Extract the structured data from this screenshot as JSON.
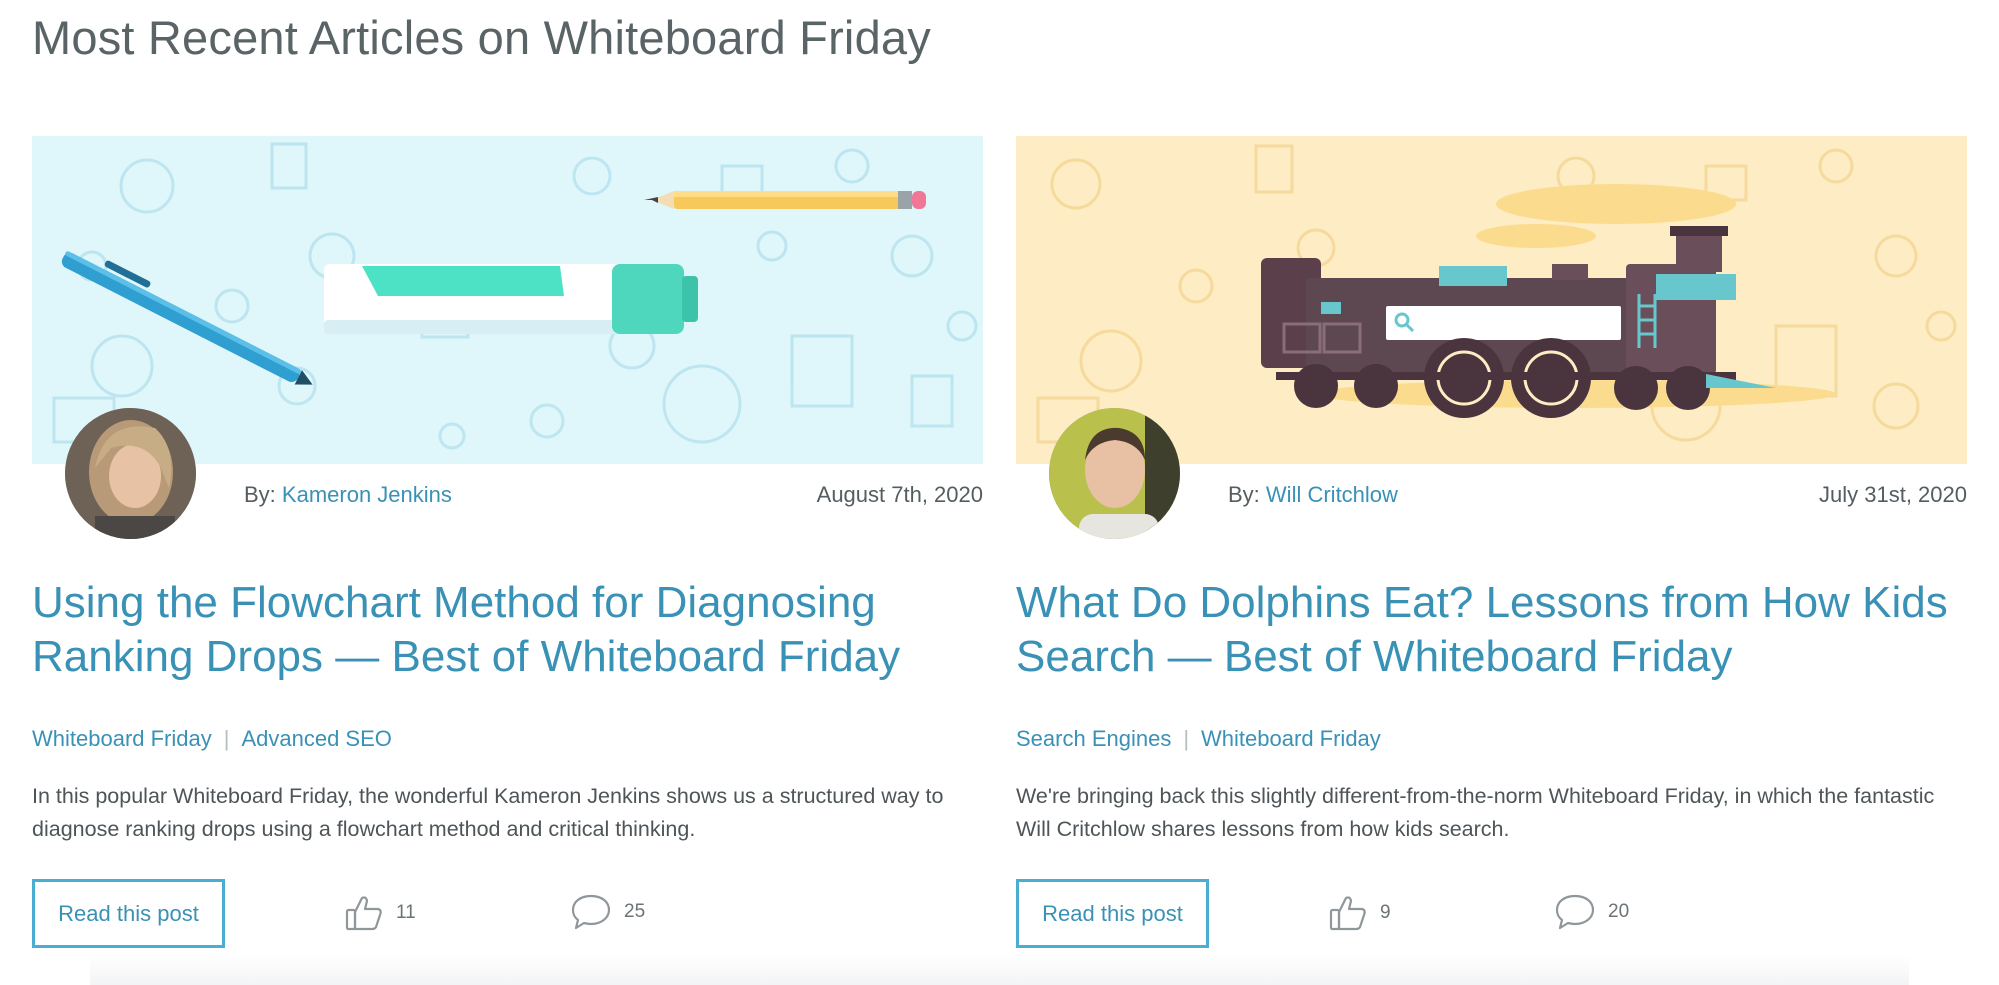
{
  "page": {
    "title": "Most Recent Articles on Whiteboard Friday"
  },
  "articles": [
    {
      "image_theme": "whiteboard tools: marker, pen, pencil",
      "hero_bg": "#dff6fb",
      "by_label": "By:",
      "author": "Kameron Jenkins",
      "date": "August 7th, 2020",
      "title": "Using the Flowchart Method for Diagnosing Ranking Drops — Best of Whiteboard Friday",
      "categories": [
        "Whiteboard Friday",
        "Advanced SEO"
      ],
      "excerpt": "In this popular Whiteboard Friday, the wonderful Kameron Jenkins shows us a structured way to diagnose ranking drops using a flowchart method and critical thinking.",
      "read_label": "Read this post",
      "likes": "11",
      "comments": "25"
    },
    {
      "image_theme": "train with search bar",
      "hero_bg": "#fdecc4",
      "by_label": "By:",
      "author": "Will Critchlow",
      "date": "July 31st, 2020",
      "title": "What Do Dolphins Eat? Lessons from How Kids Search — Best of Whiteboard Friday",
      "categories": [
        "Search Engines",
        "Whiteboard Friday"
      ],
      "excerpt": "We're bringing back this slightly different-from-the-norm Whiteboard Friday, in which the fantastic Will Critchlow shares lessons from how kids search.",
      "read_label": "Read this post",
      "likes": "9",
      "comments": "20"
    }
  ],
  "colors": {
    "link": "#3a91b6",
    "button_border": "#4aaed2",
    "heading": "#5a6466",
    "text": "#4e5558"
  },
  "icons": [
    "thumbs-up-icon",
    "comment-icon"
  ]
}
